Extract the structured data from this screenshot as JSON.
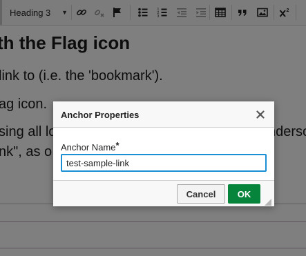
{
  "toolbar": {
    "format_select": {
      "value": "Heading 3"
    },
    "icons": [
      "link-icon",
      "unlink-icon",
      "anchor-flag-icon",
      "bulleted-list-icon",
      "numbered-list-icon",
      "decrease-indent-icon",
      "increase-indent-icon",
      "table-icon",
      "blockquote-icon",
      "image-icon",
      "superscript-icon"
    ]
  },
  "content": {
    "heading": "th the Flag icon",
    "lines": [
      "link to (i.e. the 'bookmark').",
      "ag icon.",
      "sing all lo",
      "nk\", as o"
    ],
    "right_fragment": "nderso"
  },
  "dialog": {
    "title": "Anchor Properties",
    "field_label": "Anchor Name",
    "required_mark": "*",
    "field_value": "test-sample-link",
    "cancel_label": "Cancel",
    "ok_label": "OK"
  },
  "colors": {
    "ok_button": "#06843c",
    "input_focus_border": "#1a8fd6",
    "overlay": "rgba(0,0,0,0.5)"
  }
}
